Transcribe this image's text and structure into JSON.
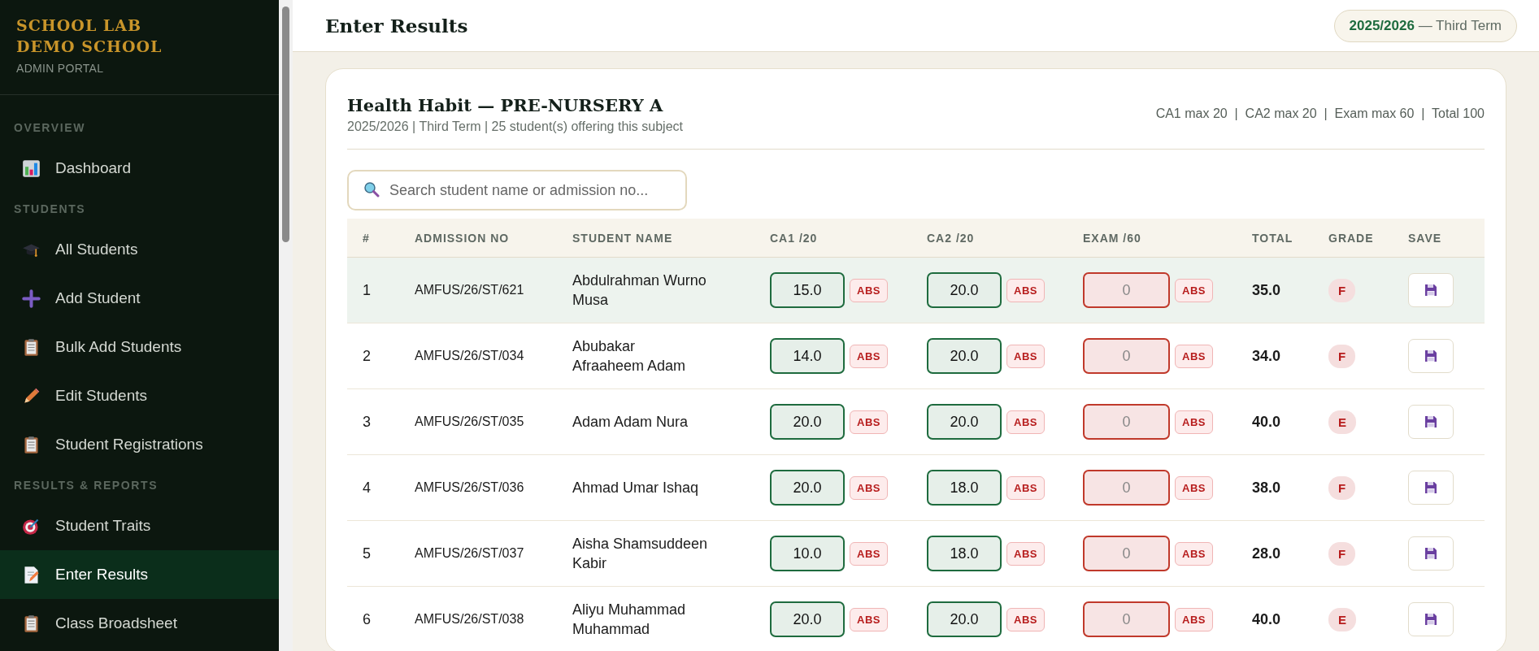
{
  "sidebar": {
    "brand": [
      "SCHOOL LAB",
      "DEMO SCHOOL"
    ],
    "subtitle": "ADMIN PORTAL",
    "sections": [
      {
        "heading": "OVERVIEW",
        "items": [
          {
            "label": "Dashboard",
            "kind": "chart",
            "selected": false
          }
        ]
      },
      {
        "heading": "STUDENTS",
        "items": [
          {
            "label": "All Students",
            "kind": "cap",
            "selected": false
          },
          {
            "label": "Add Student",
            "kind": "plus",
            "selected": false
          },
          {
            "label": "Bulk Add Students",
            "kind": "clipboard",
            "selected": false
          },
          {
            "label": "Edit Students",
            "kind": "pencil",
            "selected": false
          },
          {
            "label": "Student Registrations",
            "kind": "clipboard",
            "selected": false
          }
        ]
      },
      {
        "heading": "RESULTS & REPORTS",
        "items": [
          {
            "label": "Student Traits",
            "kind": "target",
            "selected": false
          },
          {
            "label": "Enter Results",
            "kind": "memo",
            "selected": true
          },
          {
            "label": "Class Broadsheet",
            "kind": "clipboard",
            "selected": false
          }
        ]
      }
    ]
  },
  "header": {
    "title": "Enter Results",
    "session": "2025/2026",
    "term": "— Third Term"
  },
  "card": {
    "title": "Health Habit — PRE-NURSERY A",
    "subtitle": "2025/2026 | Third Term | 25 student(s) offering this subject",
    "limits": "CA1 max 20  |  CA2 max 20  |  Exam max 60  |  Total 100",
    "search": {
      "placeholder": "Search student name or admission no..."
    },
    "table": {
      "columns": [
        "#",
        "ADMISSION NO",
        "STUDENT NAME",
        "CA1 /20",
        "CA2 /20",
        "EXAM /60",
        "TOTAL",
        "GRADE",
        "SAVE"
      ],
      "rows": [
        {
          "number": "1",
          "admission_no": "AMFUS/26/ST/621",
          "name": "Abdulrahman Wurno Musa",
          "scores": [
            {
              "value": "15.0",
              "missing": false,
              "abs": "ABS"
            },
            {
              "value": "20.0",
              "missing": false,
              "abs": "ABS"
            },
            {
              "placeholder": "0",
              "missing": true,
              "abs": "ABS"
            }
          ],
          "total": "35.0",
          "grade": "F",
          "selected": true
        },
        {
          "number": "2",
          "admission_no": "AMFUS/26/ST/034",
          "name": "Abubakar Afraaheem Adam",
          "scores": [
            {
              "value": "14.0",
              "missing": false,
              "abs": "ABS"
            },
            {
              "value": "20.0",
              "missing": false,
              "abs": "ABS"
            },
            {
              "placeholder": "0",
              "missing": true,
              "abs": "ABS"
            }
          ],
          "total": "34.0",
          "grade": "F",
          "selected": false
        },
        {
          "number": "3",
          "admission_no": "AMFUS/26/ST/035",
          "name": "Adam Adam Nura",
          "scores": [
            {
              "value": "20.0",
              "missing": false,
              "abs": "ABS"
            },
            {
              "value": "20.0",
              "missing": false,
              "abs": "ABS"
            },
            {
              "placeholder": "0",
              "missing": true,
              "abs": "ABS"
            }
          ],
          "total": "40.0",
          "grade": "E",
          "selected": false
        },
        {
          "number": "4",
          "admission_no": "AMFUS/26/ST/036",
          "name": "Ahmad Umar Ishaq",
          "scores": [
            {
              "value": "20.0",
              "missing": false,
              "abs": "ABS"
            },
            {
              "value": "18.0",
              "missing": false,
              "abs": "ABS"
            },
            {
              "placeholder": "0",
              "missing": true,
              "abs": "ABS"
            }
          ],
          "total": "38.0",
          "grade": "F",
          "selected": false
        },
        {
          "number": "5",
          "admission_no": "AMFUS/26/ST/037",
          "name": "Aisha Shamsuddeen Kabir",
          "scores": [
            {
              "value": "10.0",
              "missing": false,
              "abs": "ABS"
            },
            {
              "value": "18.0",
              "missing": false,
              "abs": "ABS"
            },
            {
              "placeholder": "0",
              "missing": true,
              "abs": "ABS"
            }
          ],
          "total": "28.0",
          "grade": "F",
          "selected": false
        },
        {
          "number": "6",
          "admission_no": "AMFUS/26/ST/038",
          "name": "Aliyu Muhammad Muhammad",
          "scores": [
            {
              "value": "20.0",
              "missing": false,
              "abs": "ABS"
            },
            {
              "value": "20.0",
              "missing": false,
              "abs": "ABS"
            },
            {
              "placeholder": "0",
              "missing": true,
              "abs": "ABS"
            }
          ],
          "total": "40.0",
          "grade": "E",
          "selected": false
        }
      ]
    }
  }
}
